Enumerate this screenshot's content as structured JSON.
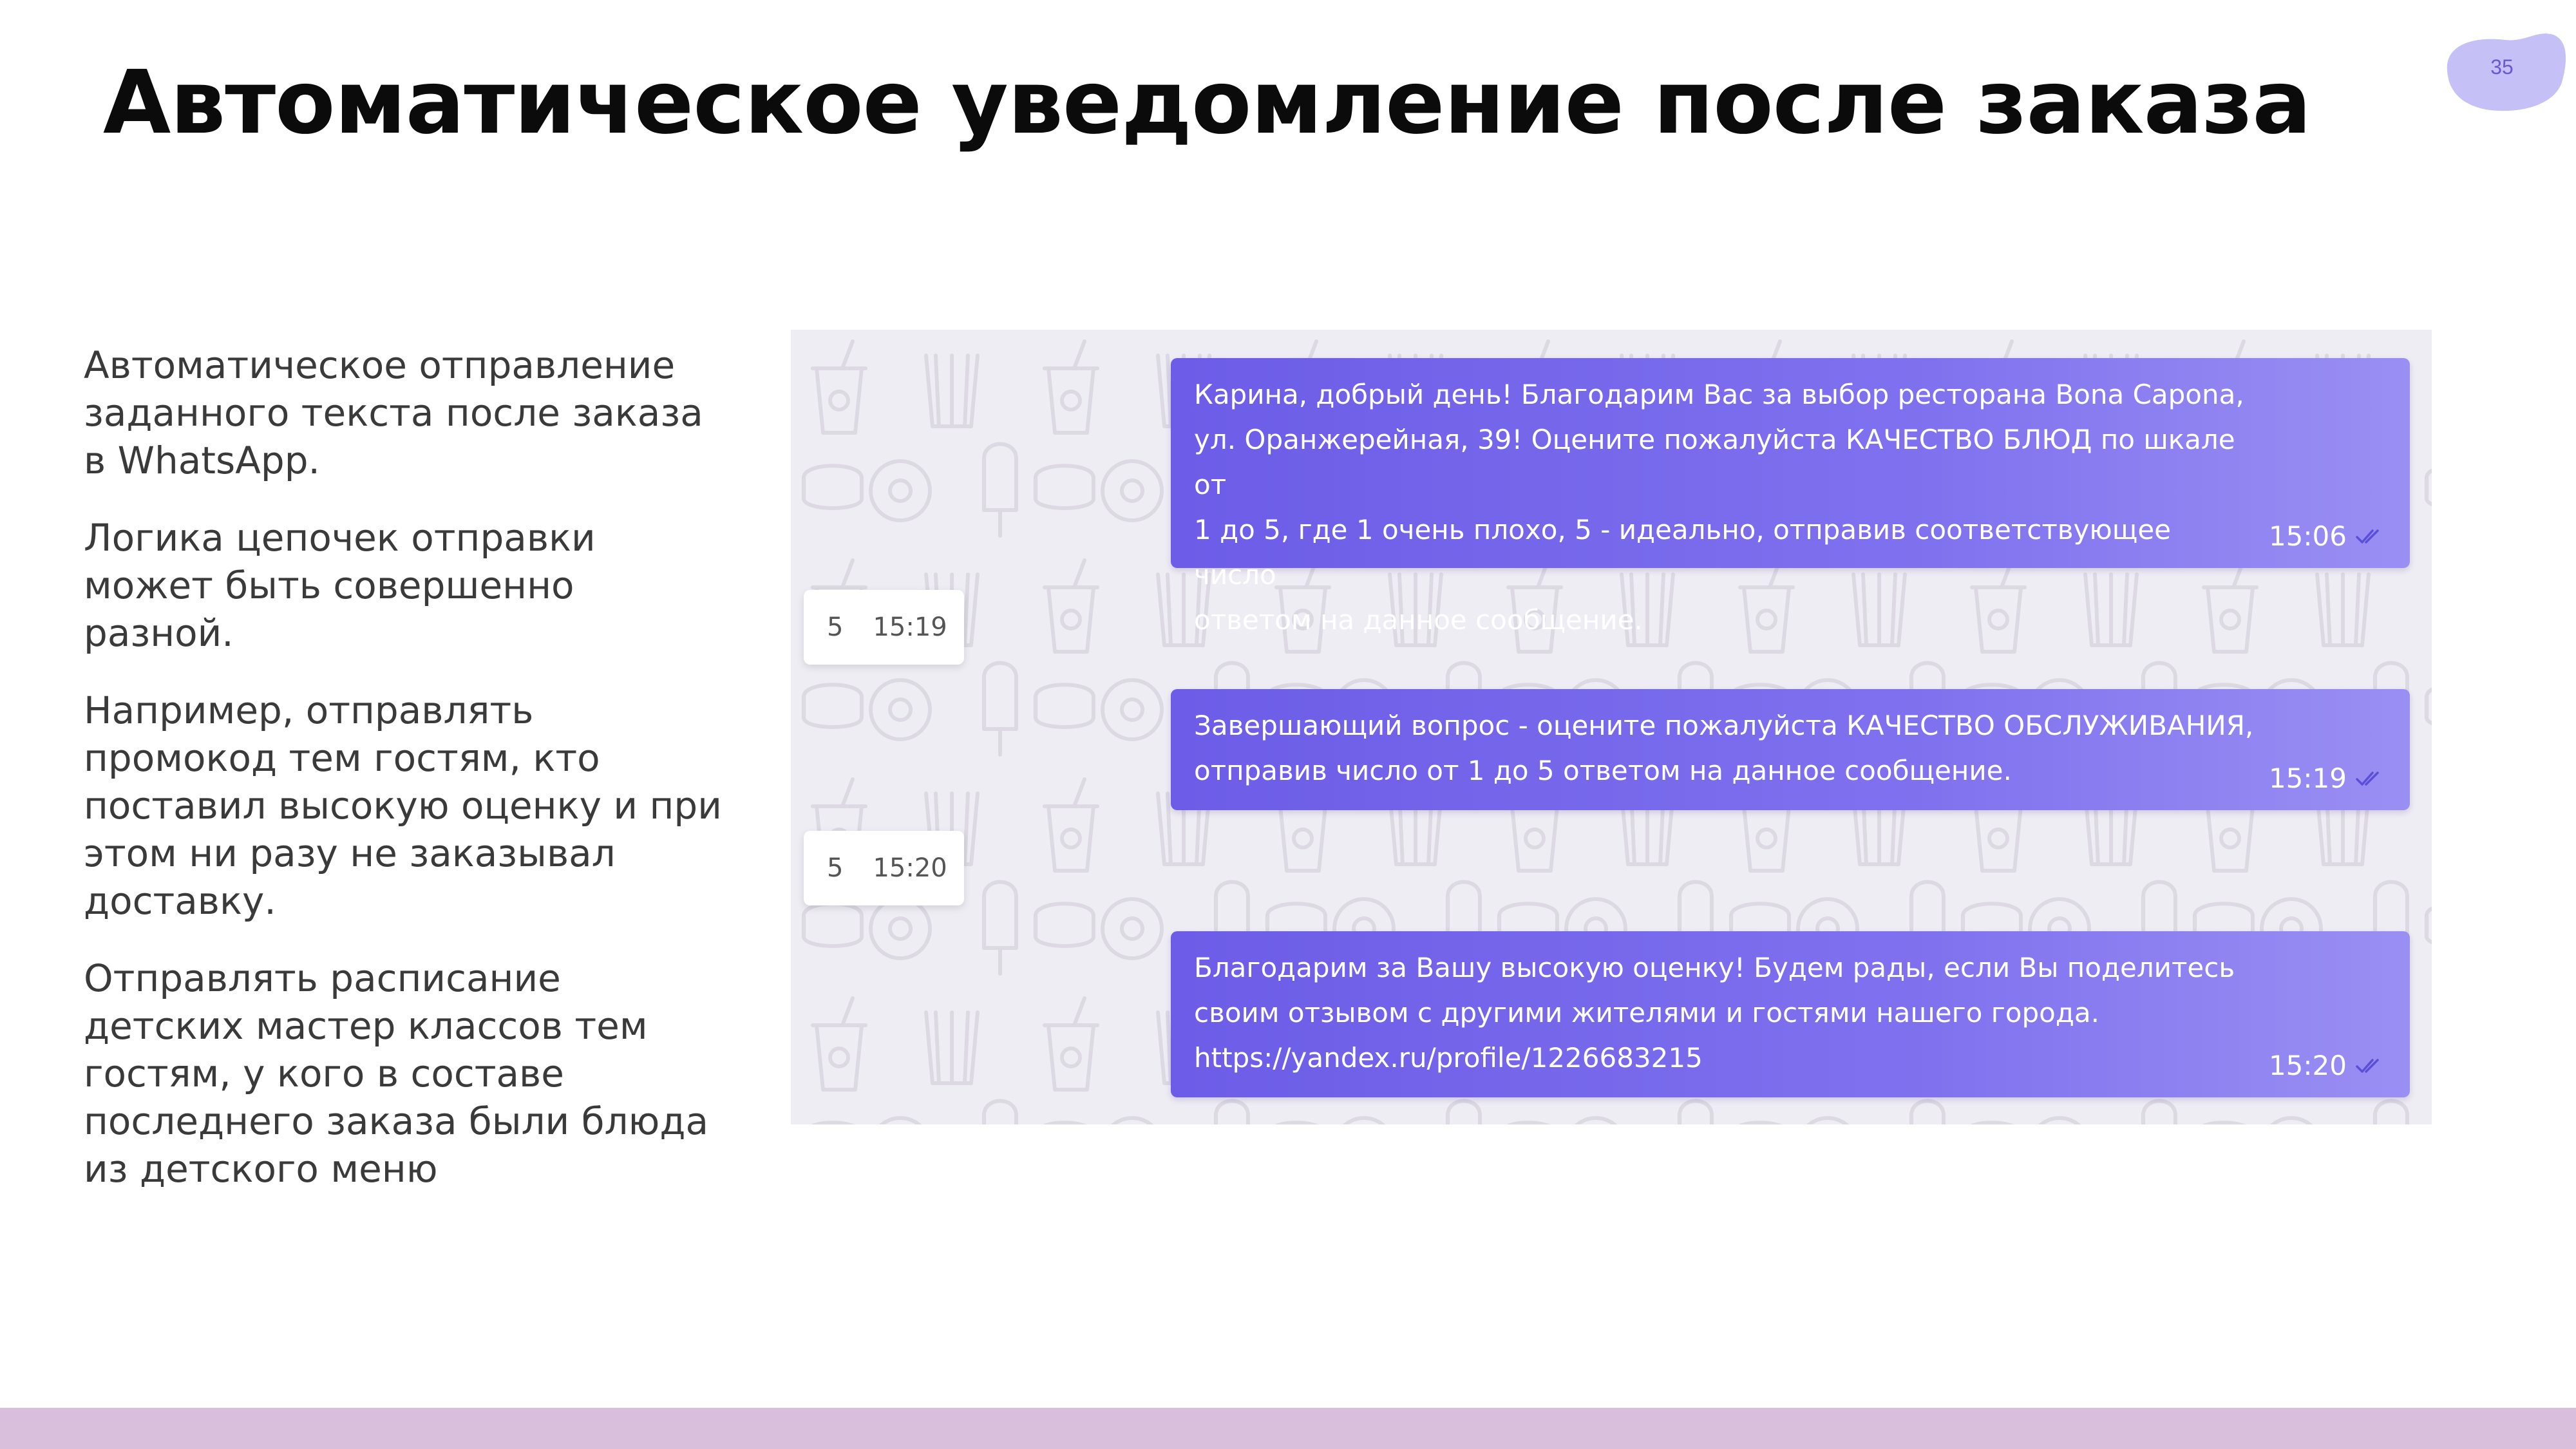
{
  "slide": {
    "title": "Автоматическое уведомление после заказа",
    "page_number": "35"
  },
  "description": {
    "paragraphs": [
      "Автоматическое отправление заданного текста после заказа в WhatsApp.",
      "Логика цепочек отправки может быть совершенно разной.",
      "Например, отправлять промокод тем гостям, кто поставил высокую оценку и при этом ни разу не заказывал доставку.",
      "Отправлять расписание детских мастер классов тем гостям, у кого в составе последнего заказа были блюда из детского меню"
    ]
  },
  "chat": {
    "messages": [
      {
        "text": "Карина, добрый день! Благодарим Вас за выбор ресторана Bona Capona,\nул. Оранжерейная, 39! Оцените пожалуйста КАЧЕСТВО БЛЮД по шкале от\n1 до 5, где 1 очень плохо, 5 - идеально, отправив соответствующее число\nответом на данное сообщение.",
        "time": "15:06",
        "status_icon": "double-check-icon"
      },
      {
        "text": "Завершающий вопрос - оцените пожалуйста КАЧЕСТВО ОБСЛУЖИВАНИЯ,\nотправив число от 1 до 5 ответом на данное сообщение.",
        "time": "15:19",
        "status_icon": "double-check-icon"
      },
      {
        "text": "Благодарим за Вашу высокую оценку! Будем рады, если Вы поделитесь\nсвоим отзывом с другими жителями и гостями нашего города.\nhttps://yandex.ru/profile/1226683215",
        "time": "15:20",
        "status_icon": "double-check-icon"
      }
    ],
    "replies": [
      {
        "value": "5",
        "time": "15:19"
      },
      {
        "value": "5",
        "time": "15:20"
      }
    ]
  },
  "colors": {
    "bubble_start": "#6c5ce7",
    "bubble_end": "#9a8ff3",
    "chat_background": "#efedf4",
    "footer_bar": "#d9bfdc",
    "badge": "#c5c0f5"
  }
}
